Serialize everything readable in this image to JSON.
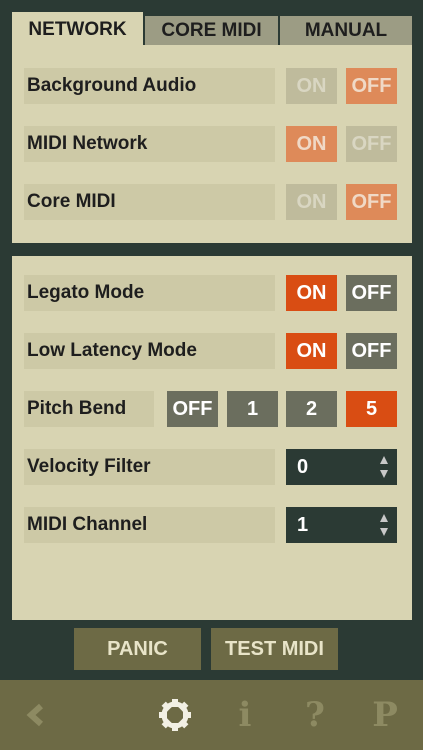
{
  "tabs": [
    {
      "label": "NETWORK",
      "active": true
    },
    {
      "label": "CORE MIDI",
      "active": false
    },
    {
      "label": "MANUAL",
      "active": false
    }
  ],
  "network_settings": [
    {
      "label": "Background Audio",
      "on_label": "ON",
      "off_label": "OFF",
      "value": "OFF"
    },
    {
      "label": "MIDI Network",
      "on_label": "ON",
      "off_label": "OFF",
      "value": "ON"
    },
    {
      "label": "Core MIDI",
      "on_label": "ON",
      "off_label": "OFF",
      "value": "OFF"
    }
  ],
  "play_settings": {
    "legato": {
      "label": "Legato Mode",
      "on_label": "ON",
      "off_label": "OFF",
      "value": "ON"
    },
    "low_latency": {
      "label": "Low Latency Mode",
      "on_label": "ON",
      "off_label": "OFF",
      "value": "ON"
    },
    "pitch_bend": {
      "label": "Pitch Bend",
      "options": [
        "OFF",
        "1",
        "2",
        "5"
      ],
      "selected": "5"
    },
    "velocity_filter": {
      "label": "Velocity Filter",
      "value": "0"
    },
    "midi_channel": {
      "label": "MIDI Channel",
      "value": "1"
    }
  },
  "actions": {
    "panic_label": "PANIC",
    "test_midi_label": "TEST MIDI"
  },
  "toolbar": {
    "back_icon": "back-chevron",
    "settings_icon": "gear",
    "info_glyph": "i",
    "help_glyph": "?",
    "p_glyph": "P",
    "active": "settings"
  },
  "colors": {
    "background": "#2b3a34",
    "panel": "#d8d4b2",
    "accent_on": "#d94d13",
    "toolbar": "#6d6a45"
  }
}
